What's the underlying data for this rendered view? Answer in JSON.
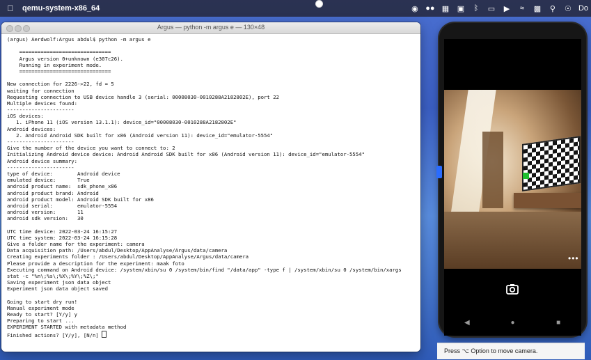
{
  "menubar": {
    "app_name": "qemu-system-x86_64",
    "clock": "Do"
  },
  "terminal": {
    "window_title": "Argus — python -m argus e — 130×48",
    "lines": [
      "(argus) Aerdwolf:Argus abdul$ python -m argus e",
      "",
      "    ==============================",
      "    Argus version 0+unknown (e307c26).",
      "    Running in experiment mode.",
      "    ==============================",
      "",
      "New connection for 2226->22, fd = 5",
      "waiting for connection",
      "Requesting connection to USB device handle 3 (serial: 00008030-0010288A2182802E), port 22",
      "Multiple devices found:",
      "----------------------",
      "iOS devices:",
      "   1. iPhone 11 (iOS version 13.1.1): device_id=\"00008030-0010288A2182802E\"",
      "Android devices:",
      "   2. Android Android SDK built for x86 (Android version 11): device_id=\"emulator-5554\"",
      "----------------------",
      "Give the number of the device you want to connect to: 2",
      "Initializing Android device device: Android Android SDK built for x86 (Android version 11): device_id=\"emulator-5554\"",
      "Android device summary:",
      "----------------------",
      "type of device:        Android device",
      "emulated device:       True",
      "android product name:  sdk_phone_x86",
      "android product brand: Android",
      "android product model: Android SDK built for x86",
      "android serial:        emulator-5554",
      "android version:       11",
      "android sdk version:   30",
      "",
      "UTC time device: 2022-03-24 16:15:27",
      "UTC time system: 2022-03-24 16:15:28",
      "Give a folder name for the experiment: camera",
      "Data acquisition path: /Users/abdul/Desktop/AppAnalyse/Argus/data/camera",
      "Creating experiments folder : /Users/abdul/Desktop/AppAnalyse/Argus/data/camera",
      "Please provide a description for the experiment: maak foto",
      "Executing command on Android device: /system/xbin/su 0 /system/bin/find \"/data/app\" -type f | /system/xbin/su 0 /system/bin/xargs",
      "stat -c \"%n\\;%s\\;%X\\;%Y\\;%Z\\;\"",
      "Saving experiment json data object",
      "Experiment json data object saved",
      "",
      "Going to start dry run!",
      "Manual experiment mode",
      "Ready to start? [Y/y] y",
      "Preparing to start ...",
      "EXPERIMENT STARTED with metadata method",
      "Finished actions? [Y/y], [N/n] "
    ]
  },
  "emulator": {
    "overflow_label": "•••"
  },
  "hint": {
    "text": "Press ⌥ Option to move camera."
  }
}
